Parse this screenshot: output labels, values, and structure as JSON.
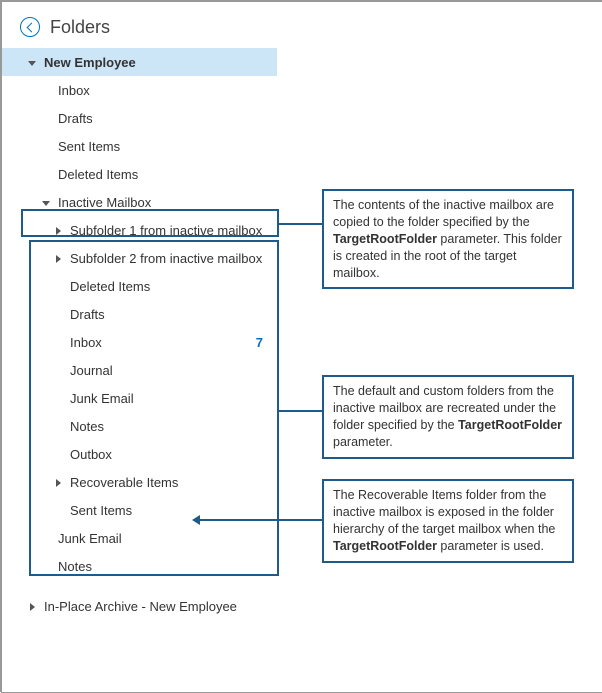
{
  "header": {
    "title": "Folders"
  },
  "accent": "#0072c6",
  "callout_border": "#1f5a8c",
  "tree": {
    "root": {
      "label": "New Employee",
      "children": [
        {
          "label": "Inbox"
        },
        {
          "label": "Drafts"
        },
        {
          "label": "Sent Items"
        },
        {
          "label": "Deleted Items"
        },
        {
          "label": "Inactive Mailbox",
          "expanded": true,
          "is_target_root": true,
          "children": [
            {
              "label": "Subfolder 1 from inactive mailbox",
              "has_children": true
            },
            {
              "label": "Subfolder 2 from inactive mailbox",
              "has_children": true
            },
            {
              "label": "Deleted Items"
            },
            {
              "label": "Drafts"
            },
            {
              "label": "Inbox",
              "count": 7
            },
            {
              "label": "Journal"
            },
            {
              "label": "Junk Email"
            },
            {
              "label": "Notes"
            },
            {
              "label": "Outbox"
            },
            {
              "label": "Recoverable Items",
              "has_children": true
            },
            {
              "label": "Sent Items"
            }
          ]
        },
        {
          "label": "Junk Email"
        },
        {
          "label": "Notes"
        }
      ]
    },
    "archive": {
      "label": "In-Place Archive - New Employee",
      "has_children": true
    }
  },
  "callouts": {
    "c1": {
      "prefix": "The contents of the inactive mailbox are copied to the folder specified by the ",
      "bold": "TargetRootFolder",
      "suffix": " parameter. This folder is created in the root of the target mailbox."
    },
    "c2": {
      "prefix": "The default and custom folders from the inactive mailbox are recreated under the folder specified by the ",
      "bold": "TargetRootFolder",
      "suffix": " parameter."
    },
    "c3": {
      "prefix": "The Recoverable Items folder from the inactive mailbox is exposed in the folder hierarchy of the target mailbox when the ",
      "bold": "TargetRootFolder",
      "suffix": " parameter is used."
    }
  }
}
